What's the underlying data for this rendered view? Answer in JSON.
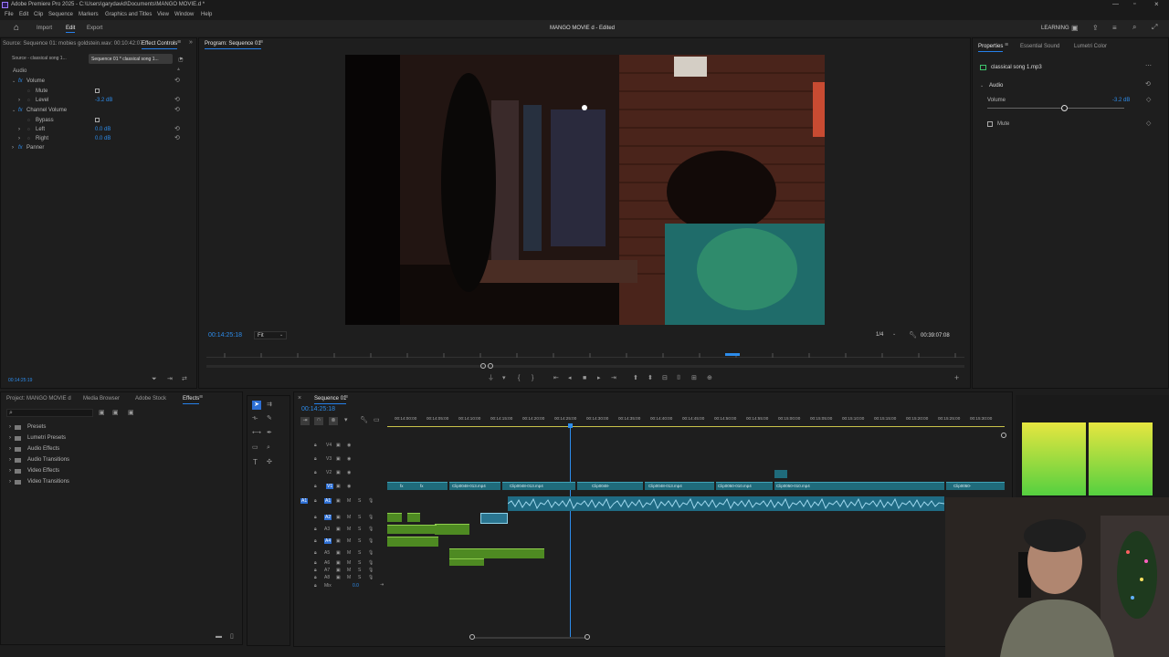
{
  "titlebar": {
    "title": "Adobe Premiere Pro 2025 - C:\\Users\\garydavid\\Documents\\MANGO MOVIE.d *"
  },
  "menu": [
    "File",
    "Edit",
    "Clip",
    "Sequence",
    "Markers",
    "Graphics and Titles",
    "View",
    "Window",
    "Help"
  ],
  "header": {
    "tabs": [
      "Import",
      "Edit",
      "Export"
    ],
    "active_tab": "Edit",
    "project_title": "MANGO MOVIE d - Edited",
    "learning_label": "LEARNING"
  },
  "effect_controls": {
    "source_tab": "Source: Sequence 01: mobies goldstein.wav: 00:10:42:07",
    "panel_tab": "Effect Controls",
    "subtab_source": "Source - classical song 1...",
    "subtab_seq": "Sequence 01 * classical song 1...",
    "section_audio": "Audio",
    "rows": [
      {
        "label": "Volume",
        "value": ""
      },
      {
        "label": "Mute",
        "value": ""
      },
      {
        "label": "Level",
        "value": "-3.2 dB"
      },
      {
        "label": "Channel Volume",
        "value": ""
      },
      {
        "label": "Bypass",
        "value": ""
      },
      {
        "label": "Left",
        "value": "0.0 dB"
      },
      {
        "label": "Right",
        "value": "0.0 dB"
      },
      {
        "label": "Panner",
        "value": ""
      }
    ],
    "timecode": "00:14:25:19"
  },
  "program_monitor": {
    "tab": "Program: Sequence 01",
    "timecode": "00:14:25:18",
    "fit": "Fit",
    "resolution": "1/4",
    "duration": "00:39:07:08"
  },
  "properties": {
    "tabs": [
      "Properties",
      "Essential Sound",
      "Lumetri Color"
    ],
    "clip_name": "classical song 1.mp3",
    "section": "Audio",
    "volume_label": "Volume",
    "volume_value": "-3.2 dB",
    "mute_label": "Mute"
  },
  "project_panel": {
    "tabs": [
      "Project: MANGO MOVIE d",
      "Media Browser",
      "Adobe Stock",
      "Effects"
    ],
    "active_tab": "Effects",
    "folders": [
      "Presets",
      "Lumetri Presets",
      "Audio Effects",
      "Audio Transitions",
      "Video Effects",
      "Video Transitions"
    ]
  },
  "timeline": {
    "tab": "Sequence 01",
    "timecode": "00:14:25:18",
    "ruler": [
      "00:14:00:00",
      "00:14:05:00",
      "00:14:10:00",
      "00:14:15:00",
      "00:14:20:00",
      "00:14:25:00",
      "00:14:30:00",
      "00:14:35:00",
      "00:14:40:00",
      "00:14:45:00",
      "00:14:50:00",
      "00:14:55:00",
      "00:15:00:00",
      "00:15:05:00",
      "00:15:10:00",
      "00:15:15:00",
      "00:15:20:00",
      "00:15:25:00",
      "00:15:30:00"
    ],
    "video_tracks": [
      "V4",
      "V3",
      "V2",
      "V1"
    ],
    "audio_tracks": [
      "A1",
      "A2",
      "A3",
      "A4",
      "A5",
      "A6",
      "A7",
      "A8"
    ],
    "mix_label": "Mix",
    "mix_value": "0.0",
    "clips": [
      "Clip0048-013.mp4",
      "Clip0048-013.mp4",
      "Clip0048-",
      "Clip0048-013.mp4",
      "Clip0050-010.mp4",
      "Clip0050-010.mp4",
      "Clip0050-"
    ]
  }
}
